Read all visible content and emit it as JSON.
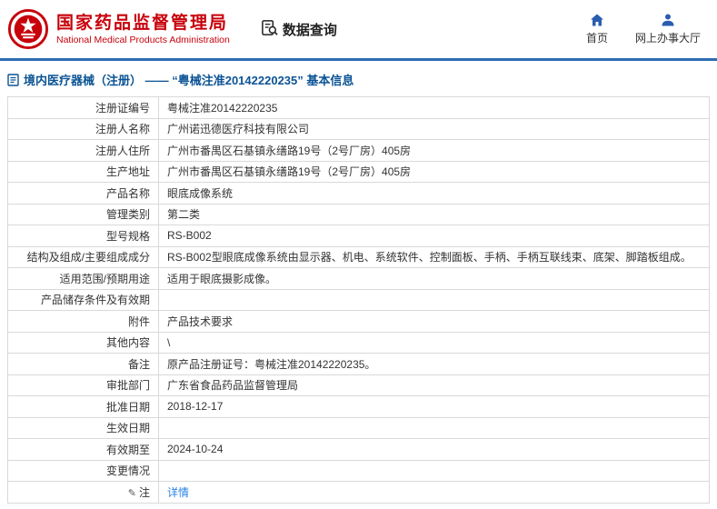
{
  "colors": {
    "brand_red": "#c7000a",
    "accent_blue": "#2d6bb4",
    "nav_icon_blue": "#2a5db0",
    "title_blue": "#0b5394",
    "link_blue": "#2a82e4"
  },
  "header": {
    "org_name_cn": "国家药品监督管理局",
    "org_name_en": "National Medical Products Administration",
    "section_title": "数据查询",
    "nav": [
      {
        "label": "首页",
        "icon": "home-icon"
      },
      {
        "label": "网上办事大厅",
        "icon": "user-icon"
      }
    ]
  },
  "breadcrumb": {
    "icon": "document-icon",
    "text": "境内医疗器械（注册） —— “粤械注准20142220235” 基本信息"
  },
  "table": {
    "rows": [
      {
        "label": "注册证编号",
        "value": "粤械注准20142220235"
      },
      {
        "label": "注册人名称",
        "value": "广州诺迅德医疗科技有限公司"
      },
      {
        "label": "注册人住所",
        "value": "广州市番禺区石基镇永缮路19号（2号厂房）405房"
      },
      {
        "label": "生产地址",
        "value": "广州市番禺区石基镇永缮路19号（2号厂房）405房"
      },
      {
        "label": "产品名称",
        "value": "眼底成像系统"
      },
      {
        "label": "管理类别",
        "value": "第二类"
      },
      {
        "label": "型号规格",
        "value": "RS-B002"
      },
      {
        "label": "结构及组成/主要组成成分",
        "value": "RS-B002型眼底成像系统由显示器、机电、系统软件、控制面板、手柄、手柄互联线束、底架、脚踏板组成。"
      },
      {
        "label": "适用范围/预期用途",
        "value": "适用于眼底摄影成像。"
      },
      {
        "label": "产品储存条件及有效期",
        "value": ""
      },
      {
        "label": "附件",
        "value": "产品技术要求"
      },
      {
        "label": "其他内容",
        "value": "\\"
      },
      {
        "label": "备注",
        "value": "原产品注册证号：粤械注准20142220235。"
      },
      {
        "label": "审批部门",
        "value": "广东省食品药品监督管理局"
      },
      {
        "label": "批准日期",
        "value": "2018-12-17"
      },
      {
        "label": "生效日期",
        "value": ""
      },
      {
        "label": "有效期至",
        "value": "2024-10-24"
      },
      {
        "label": "变更情况",
        "value": ""
      },
      {
        "label": "注",
        "label_icon": "note-icon",
        "value": "详情",
        "link": true
      }
    ]
  }
}
